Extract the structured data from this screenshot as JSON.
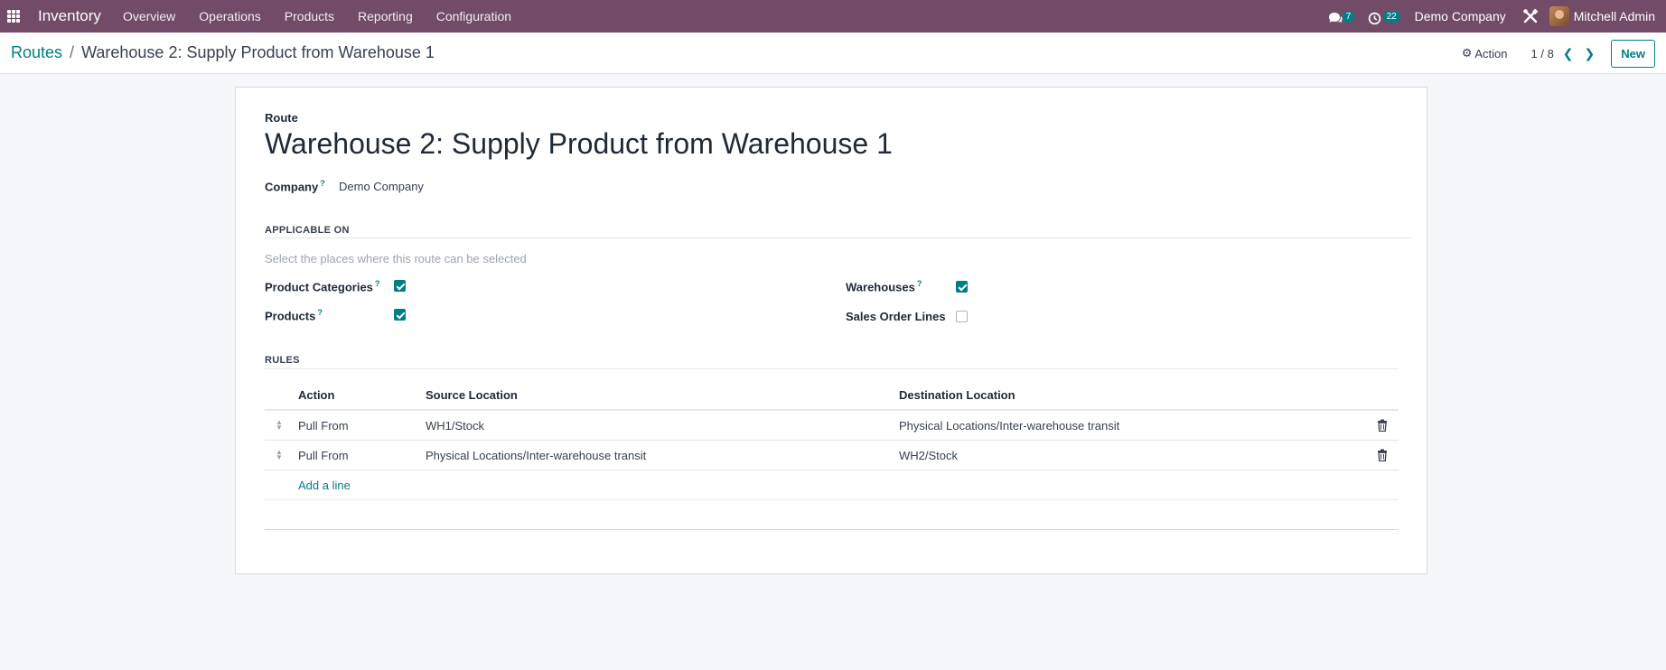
{
  "navbar": {
    "app_name": "Inventory",
    "menu": [
      "Overview",
      "Operations",
      "Products",
      "Reporting",
      "Configuration"
    ],
    "messages_count": "7",
    "activities_count": "22",
    "company": "Demo Company",
    "user_name": "Mitchell Admin"
  },
  "control_panel": {
    "breadcrumb_parent": "Routes",
    "breadcrumb_separator": "/",
    "breadcrumb_current": "Warehouse 2: Supply Product from Warehouse 1",
    "action_label": "Action",
    "pager": "1 / 8",
    "new_label": "New"
  },
  "form": {
    "route_label": "Route",
    "route_name": "Warehouse 2: Supply Product from Warehouse 1",
    "company_label": "Company",
    "company_value": "Demo Company",
    "tooltip_mark": "?",
    "applicable_on": {
      "title": "APPLICABLE ON",
      "hint": "Select the places where this route can be selected",
      "fields": [
        {
          "label": "Product Categories",
          "checked": true,
          "tooltip": true
        },
        {
          "label": "Products",
          "checked": true,
          "tooltip": true
        },
        {
          "label": "Warehouses",
          "checked": true,
          "tooltip": true
        },
        {
          "label": "Sales Order Lines",
          "checked": false,
          "tooltip": false
        }
      ]
    },
    "rules": {
      "title": "RULES",
      "columns": [
        "Action",
        "Source Location",
        "Destination Location"
      ],
      "rows": [
        {
          "action": "Pull From",
          "source": "WH1/Stock",
          "destination": "Physical Locations/Inter-warehouse transit"
        },
        {
          "action": "Pull From",
          "source": "Physical Locations/Inter-warehouse transit",
          "destination": "WH2/Stock"
        }
      ],
      "add_line_label": "Add a line"
    }
  },
  "colors": {
    "navbar": "#714b67",
    "accent": "#017e84"
  }
}
